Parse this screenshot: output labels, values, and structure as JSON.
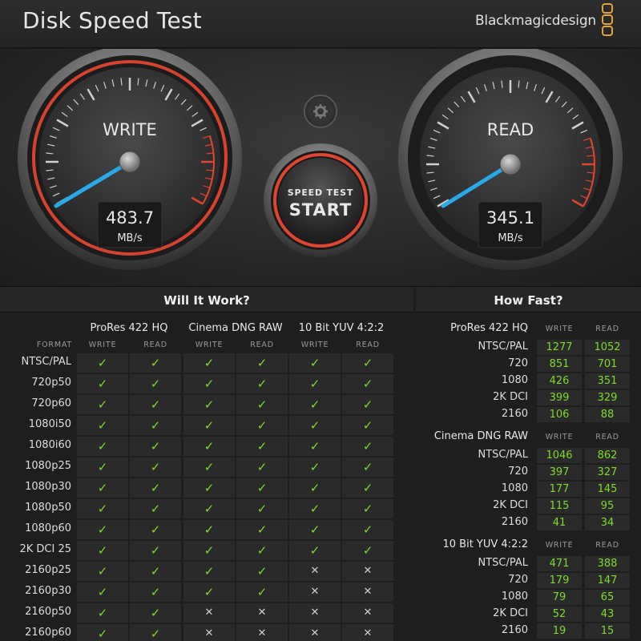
{
  "header": {
    "title": "Disk Speed Test",
    "brand": "Blackmagicdesign"
  },
  "gauges": {
    "write": {
      "label": "WRITE",
      "value": "483.7",
      "unit": "MB/s"
    },
    "read": {
      "label": "READ",
      "value": "345.1",
      "unit": "MB/s"
    },
    "start_button": {
      "line1": "SPEED TEST",
      "line2": "START"
    },
    "settings_icon": "gear-icon"
  },
  "will_it_work": {
    "title": "Will It Work?",
    "format_header": "FORMAT",
    "write_header": "WRITE",
    "read_header": "READ",
    "codecs": [
      "ProRes 422 HQ",
      "Cinema DNG RAW",
      "10 Bit YUV 4:2:2"
    ],
    "rows": [
      {
        "format": "NTSC/PAL",
        "cells": [
          1,
          1,
          1,
          1,
          1,
          1
        ]
      },
      {
        "format": "720p50",
        "cells": [
          1,
          1,
          1,
          1,
          1,
          1
        ]
      },
      {
        "format": "720p60",
        "cells": [
          1,
          1,
          1,
          1,
          1,
          1
        ]
      },
      {
        "format": "1080i50",
        "cells": [
          1,
          1,
          1,
          1,
          1,
          1
        ]
      },
      {
        "format": "1080i60",
        "cells": [
          1,
          1,
          1,
          1,
          1,
          1
        ]
      },
      {
        "format": "1080p25",
        "cells": [
          1,
          1,
          1,
          1,
          1,
          1
        ]
      },
      {
        "format": "1080p30",
        "cells": [
          1,
          1,
          1,
          1,
          1,
          1
        ]
      },
      {
        "format": "1080p50",
        "cells": [
          1,
          1,
          1,
          1,
          1,
          1
        ]
      },
      {
        "format": "1080p60",
        "cells": [
          1,
          1,
          1,
          1,
          1,
          1
        ]
      },
      {
        "format": "2K DCI 25",
        "cells": [
          1,
          1,
          1,
          1,
          1,
          1
        ]
      },
      {
        "format": "2160p25",
        "cells": [
          1,
          1,
          1,
          1,
          0,
          0
        ]
      },
      {
        "format": "2160p30",
        "cells": [
          1,
          1,
          1,
          1,
          0,
          0
        ]
      },
      {
        "format": "2160p50",
        "cells": [
          1,
          1,
          0,
          0,
          0,
          0
        ]
      },
      {
        "format": "2160p60",
        "cells": [
          1,
          1,
          0,
          0,
          0,
          0
        ]
      }
    ],
    "check_glyph": "✓",
    "cross_glyph": "✕"
  },
  "how_fast": {
    "title": "How Fast?",
    "write_header": "WRITE",
    "read_header": "READ",
    "groups": [
      {
        "codec": "ProRes 422 HQ",
        "rows": [
          {
            "format": "NTSC/PAL",
            "write": "1277",
            "read": "1052"
          },
          {
            "format": "720",
            "write": "851",
            "read": "701"
          },
          {
            "format": "1080",
            "write": "426",
            "read": "351"
          },
          {
            "format": "2K DCI",
            "write": "399",
            "read": "329"
          },
          {
            "format": "2160",
            "write": "106",
            "read": "88"
          }
        ]
      },
      {
        "codec": "Cinema DNG RAW",
        "rows": [
          {
            "format": "NTSC/PAL",
            "write": "1046",
            "read": "862"
          },
          {
            "format": "720",
            "write": "397",
            "read": "327"
          },
          {
            "format": "1080",
            "write": "177",
            "read": "145"
          },
          {
            "format": "2K DCI",
            "write": "115",
            "read": "95"
          },
          {
            "format": "2160",
            "write": "41",
            "read": "34"
          }
        ]
      },
      {
        "codec": "10 Bit YUV 4:2:2",
        "rows": [
          {
            "format": "NTSC/PAL",
            "write": "471",
            "read": "388"
          },
          {
            "format": "720",
            "write": "179",
            "read": "147"
          },
          {
            "format": "1080",
            "write": "79",
            "read": "65"
          },
          {
            "format": "2K DCI",
            "write": "52",
            "read": "43"
          },
          {
            "format": "2160",
            "write": "19",
            "read": "15"
          }
        ]
      }
    ]
  },
  "colors": {
    "accent_red": "#e2452e",
    "needle_blue": "#28a9e8",
    "check_green": "#7ddc29"
  }
}
